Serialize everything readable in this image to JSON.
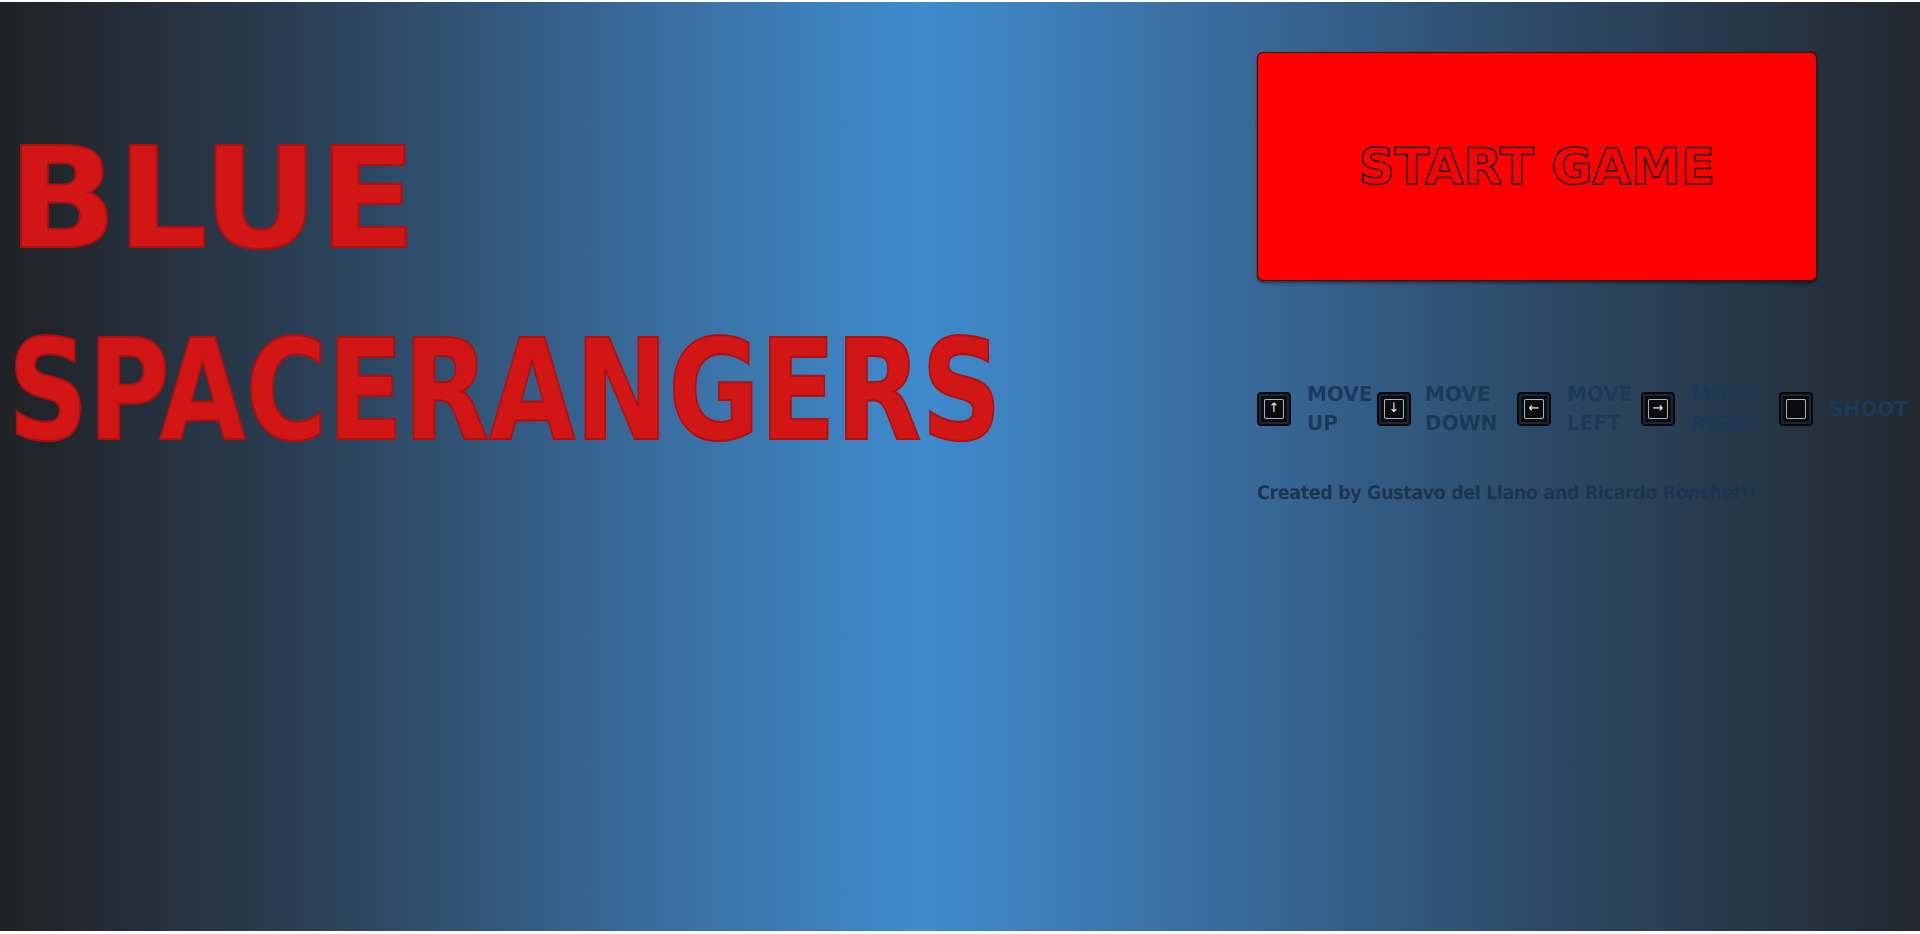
{
  "title": {
    "line1": "Blue",
    "line2": "Spacerangers"
  },
  "start_button": {
    "label": "Start Game"
  },
  "controls": [
    {
      "key_icon": "arrow-up-key",
      "glyph": "↑",
      "line1": "Move",
      "line2": "Up"
    },
    {
      "key_icon": "arrow-down-key",
      "glyph": "↓",
      "line1": "Move",
      "line2": "Down"
    },
    {
      "key_icon": "arrow-left-key",
      "glyph": "←",
      "line1": "Move",
      "line2": "Left"
    },
    {
      "key_icon": "arrow-right-key",
      "glyph": "→",
      "line1": "Move",
      "line2": "Right"
    },
    {
      "key_icon": "space-key",
      "glyph": "",
      "line1": "Shoot",
      "line2": ""
    }
  ],
  "credits": "Created by Gustavo del Llano and Ricardo Ronchetti",
  "colors": {
    "title": "#d21616",
    "button": "#ff0000",
    "background_center": "#3f8bcd",
    "background_edge": "#202124"
  }
}
